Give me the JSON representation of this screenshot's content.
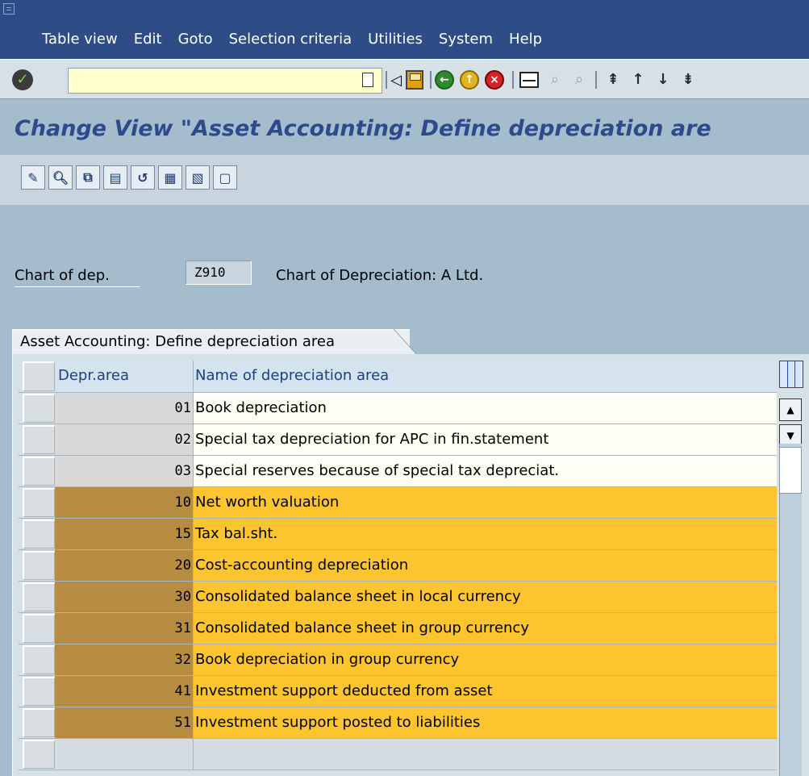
{
  "menu": {
    "items": [
      "Table view",
      "Edit",
      "Goto",
      "Selection criteria",
      "Utilities",
      "System",
      "Help"
    ]
  },
  "toolbar": {
    "command_value": "",
    "icons": [
      "enter-icon",
      "save-icon",
      "back-icon",
      "exit-icon",
      "cancel-icon",
      "print-icon",
      "find-icon",
      "find-next-icon",
      "first-page-icon",
      "previous-page-icon",
      "next-page-icon",
      "last-page-icon"
    ]
  },
  "title": "Change View \"Asset Accounting: Define depreciation are",
  "app_toolbar": {
    "icons": [
      "display-change-icon",
      "details-icon",
      "copy-icon",
      "delete-icon",
      "undo-icon",
      "select-all-icon",
      "select-block-icon",
      "deselect-all-icon"
    ]
  },
  "header": {
    "label": "Chart of dep.",
    "value": "Z910",
    "description": "Chart of Depreciation: A Ltd."
  },
  "tab": {
    "label": "Asset Accounting: Define depreciation area"
  },
  "table": {
    "columns": [
      "Depr.area",
      "Name of depreciation area"
    ],
    "rows": [
      {
        "area": "01",
        "name": "Book depreciation",
        "highlighted": false
      },
      {
        "area": "02",
        "name": "Special tax depreciation for APC in fin.statement",
        "highlighted": false
      },
      {
        "area": "03",
        "name": "Special reserves because of special tax depreciat.",
        "highlighted": false
      },
      {
        "area": "10",
        "name": "Net worth valuation",
        "highlighted": true
      },
      {
        "area": "15",
        "name": "Tax bal.sht.",
        "highlighted": true
      },
      {
        "area": "20",
        "name": "Cost-accounting depreciation",
        "highlighted": true
      },
      {
        "area": "30",
        "name": "Consolidated balance sheet in local currency",
        "highlighted": true
      },
      {
        "area": "31",
        "name": "Consolidated balance sheet in group currency",
        "highlighted": true
      },
      {
        "area": "32",
        "name": "Book depreciation in group currency",
        "highlighted": true
      },
      {
        "area": "41",
        "name": "Investment support deducted from asset",
        "highlighted": true
      },
      {
        "area": "51",
        "name": "Investment support posted to liabilities",
        "highlighted": true
      }
    ]
  },
  "colors": {
    "menu_bar": "#2e4c85",
    "title": "#2e4a8c",
    "highlight_row": "#fcc42e",
    "highlight_area": "#b58c40"
  }
}
